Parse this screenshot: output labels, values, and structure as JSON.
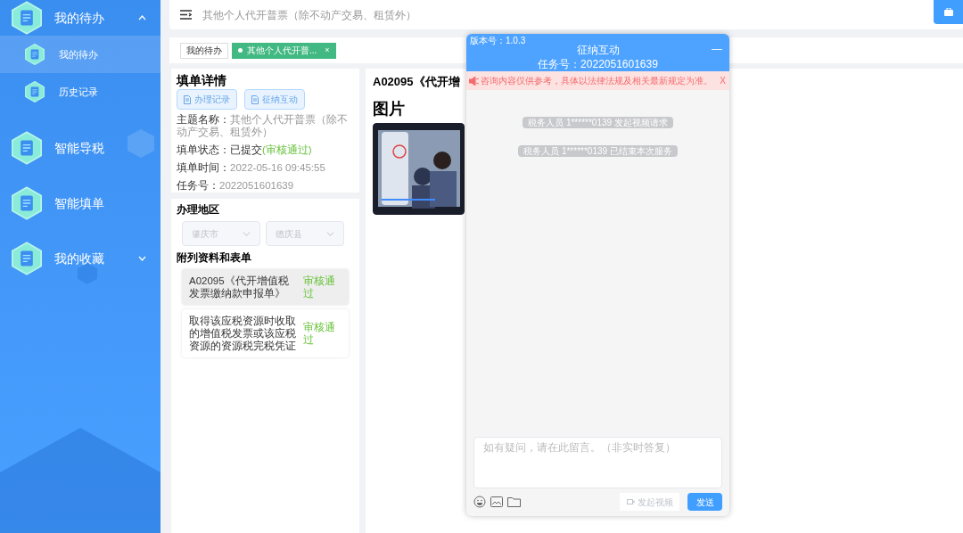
{
  "sidebar": {
    "items": [
      {
        "label": "我的待办",
        "expanded": true,
        "children": [
          {
            "label": "我的待办",
            "selected": true
          },
          {
            "label": "历史记录",
            "selected": false
          }
        ]
      },
      {
        "label": "智能导税"
      },
      {
        "label": "智能填单"
      },
      {
        "label": "我的收藏",
        "expanded": false
      }
    ]
  },
  "header": {
    "title": "其他个人代开普票（除不动产交易、租赁外）"
  },
  "tabs": [
    {
      "label": "我的待办",
      "selected": false
    },
    {
      "label": "其他个人代开普...",
      "selected": true,
      "close": "×"
    }
  ],
  "detail": {
    "title": "填单详情",
    "buttons": [
      "办理记录",
      "征纳互动"
    ],
    "fields": [
      {
        "label": "主题名称：",
        "value": "其他个人代开普票（除不动产交易、租赁外）"
      },
      {
        "label": "填单状态：",
        "value": "已提交",
        "note": "(审核通过)"
      },
      {
        "label": "填单时间：",
        "value": "2022-05-16 09:45:55"
      },
      {
        "label": "任务号：",
        "value": "2022051601639"
      }
    ]
  },
  "region": {
    "title": "办理地区",
    "selects": [
      {
        "value": "肇庆市",
        "disabled": true
      },
      {
        "value": "德庆县",
        "disabled": true
      }
    ]
  },
  "attachments": {
    "title": "附列资料和表单",
    "items": [
      {
        "name": "A02095《代开增值税发票缴纳款申报单》",
        "status": "审核通过",
        "selected": true
      },
      {
        "name": "取得该应税资源时收取的增值税发票或该应税资源的资源税完税凭证",
        "status": "审核通过",
        "selected": false
      }
    ]
  },
  "preview": {
    "title": "A02095《代开增",
    "section": "图片"
  },
  "chat": {
    "version": "版本号：1.0.3",
    "title": "征纳互动",
    "task": "任务号：2022051601639",
    "minimize": "—",
    "notice": "咨询内容仅供参考，具体以法律法规及相关最新规定为准。",
    "notice_close": "X",
    "messages": [
      "税务人员 1******0139 发起视频请求",
      "税务人员 1******0139 已结束本次服务"
    ],
    "placeholder": "如有疑问，请在此留言。（非实时答复）",
    "video_button": {
      "label": "发起视频",
      "disabled": true
    },
    "send": "发送"
  }
}
